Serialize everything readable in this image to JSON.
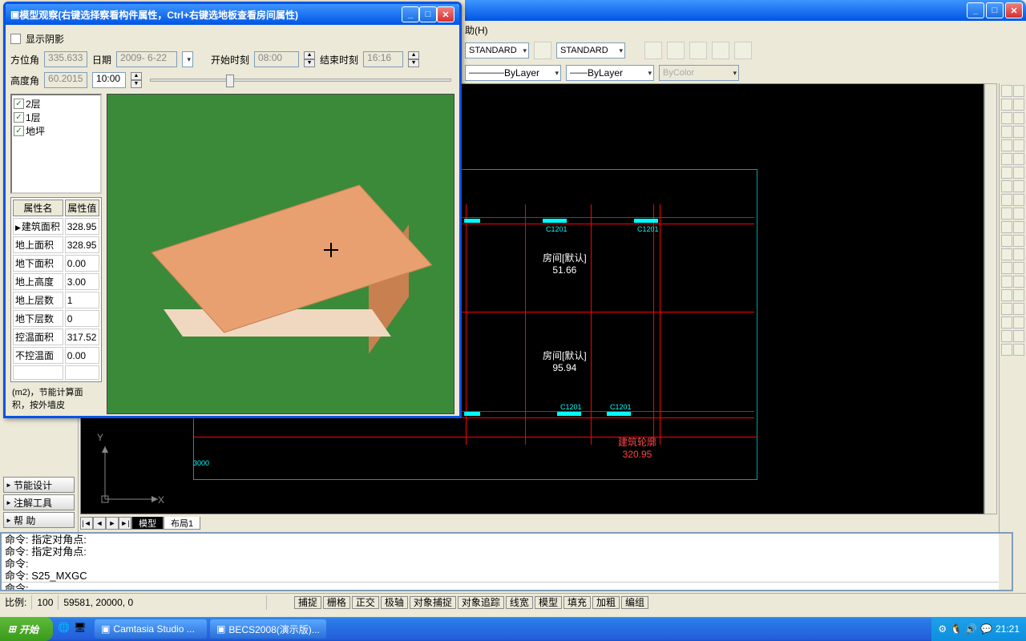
{
  "main_window": {
    "menu_help": "助(H)"
  },
  "toolbar": {
    "style1": "STANDARD",
    "style2": "STANDARD",
    "bylayer1": "ByLayer",
    "bylayer2": "ByLayer",
    "bycolor": "ByColor"
  },
  "sidebar": {
    "btn1": "节能设计",
    "btn2": "注解工具",
    "btn3": "帮    助"
  },
  "tabs": {
    "model": "模型",
    "layout1": "布局1"
  },
  "cad": {
    "dim_3000": "3000",
    "room1": "房间[默认]",
    "room1_val": "51.66",
    "room2": "房间[默认]",
    "room2_val": "95.94",
    "summary_label": "建筑轮廓",
    "summary_val": "320.95",
    "c1201": "C1201",
    "axis_x": "X",
    "axis_y": "Y"
  },
  "cmd": {
    "l1": "命令: 指定对角点:",
    "l2": "命令: 指定对角点:",
    "l3": "命令:",
    "l4": "命令:  S25_MXGC",
    "prompt": "命令:"
  },
  "status": {
    "scale_label": "比例:",
    "scale_val": "100",
    "coords": "59581, 20000, 0",
    "toggles": [
      "捕捉",
      "栅格",
      "正交",
      "极轴",
      "对象捕捉",
      "对象追踪",
      "线宽",
      "模型",
      "填充",
      "加粗",
      "编组"
    ]
  },
  "taskbar": {
    "start": "开始",
    "task1": "Camtasia Studio ...",
    "task2": "BECS2008(演示版)...",
    "time": "21:21"
  },
  "dialog": {
    "title": "模型观察(右键选择察看构件属性，Ctrl+右键选地板查看房间属性)",
    "show_shadow": "显示阴影",
    "azimuth_label": "方位角",
    "azimuth_val": "335.633",
    "date_label": "日期",
    "date_val": "2009- 6-22",
    "start_label": "开始时刻",
    "start_val": "08:00",
    "end_label": "结束时刻",
    "end_val": "16:16",
    "elev_label": "高度角",
    "elev_val": "60.2015",
    "time_val": "10:00",
    "layers": [
      "2层",
      "1层",
      "地坪"
    ],
    "prop_header_name": "属性名",
    "prop_header_val": "属性值",
    "props": [
      {
        "n": "建筑面积",
        "v": "328.95"
      },
      {
        "n": "地上面积",
        "v": "328.95"
      },
      {
        "n": "地下面积",
        "v": "0.00"
      },
      {
        "n": "地上高度",
        "v": "3.00"
      },
      {
        "n": "地上层数",
        "v": "1"
      },
      {
        "n": "地下层数",
        "v": "0"
      },
      {
        "n": "控温面积",
        "v": "317.52"
      },
      {
        "n": "不控温面",
        "v": "0.00"
      }
    ],
    "note": "(m2)，节能计算面积，按外墙皮"
  }
}
